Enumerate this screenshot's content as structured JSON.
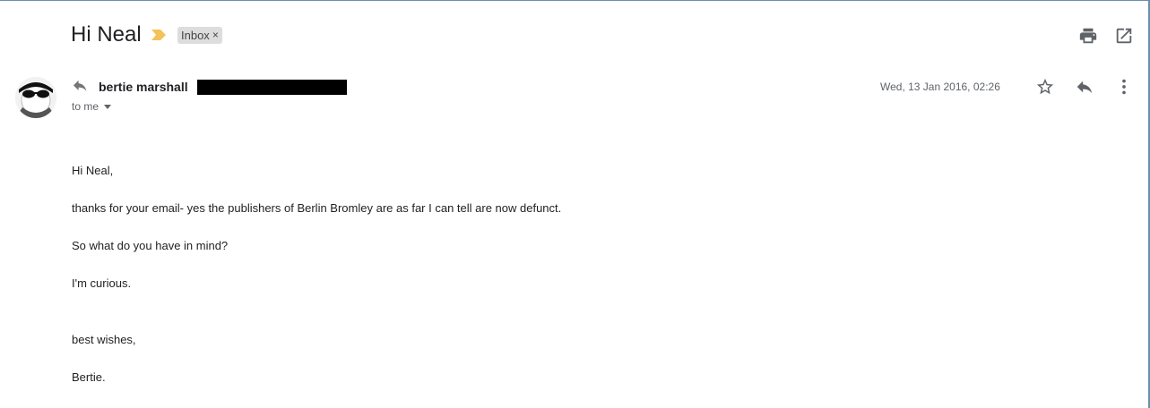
{
  "message": {
    "subject": "Hi Neal",
    "label": "Inbox",
    "label_remove_glyph": "×",
    "sender_name": "bertie marshall",
    "recipient_text": "to me",
    "date": "Wed, 13 Jan 2016, 02:26",
    "body": [
      "Hi Neal,",
      "thanks for your email- yes the publishers of Berlin Bromley are as far I can tell are now defunct.",
      "So what do you have in mind?",
      "I'm curious.",
      "best wishes,",
      "Bertie."
    ]
  },
  "colors": {
    "importance_marker": "#f4c25b",
    "label_chip_bg": "#dddddd",
    "icon_gray": "#5f6368",
    "window_border": "#6b8eaa"
  },
  "icons": {
    "importance": "importance-marker-icon",
    "print": "print-icon",
    "open_new_window": "open-in-new-window-icon",
    "sender_reply": "reply-arrow-icon",
    "star": "star-icon",
    "reply": "reply-icon",
    "more": "more-vertical-icon",
    "dropdown": "chevron-down-icon"
  }
}
